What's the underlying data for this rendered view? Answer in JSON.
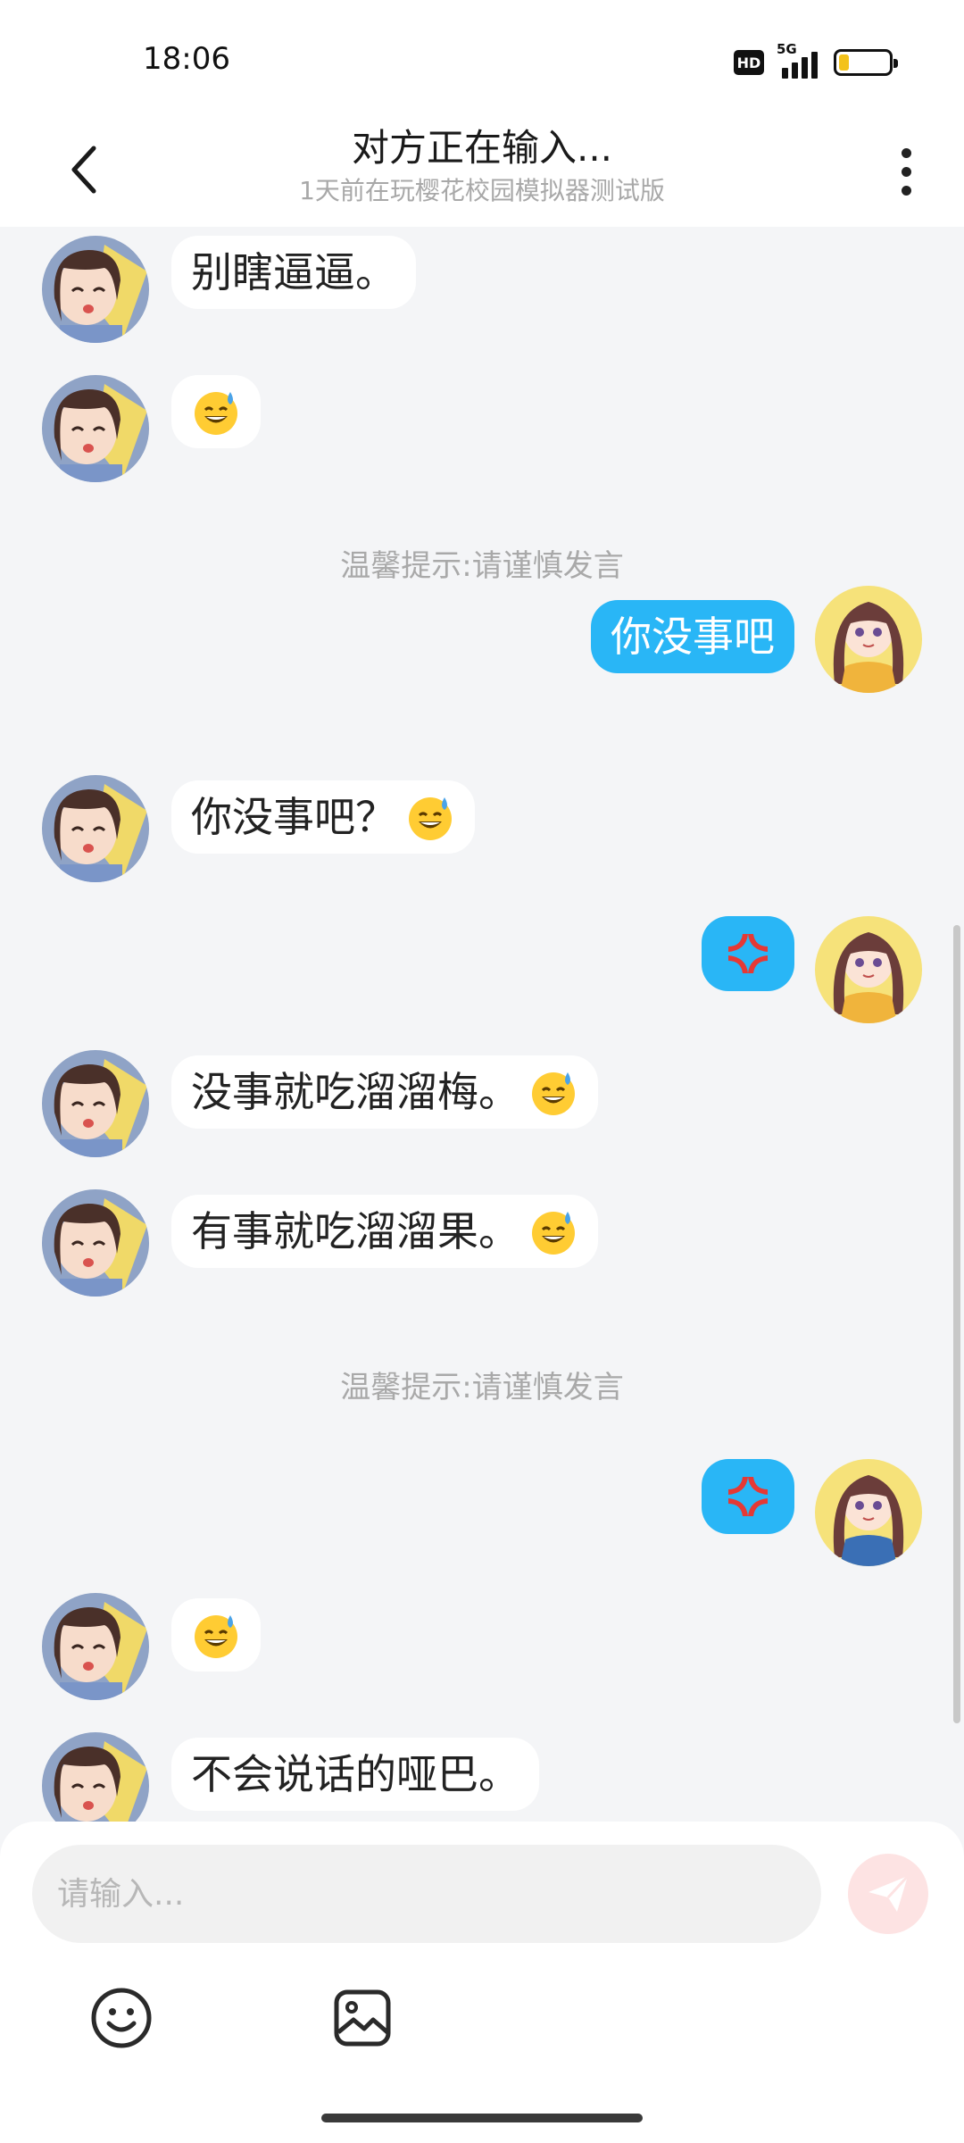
{
  "status": {
    "time": "18:06",
    "hd": "HD",
    "network": "5G",
    "battery_level": 0.2
  },
  "header": {
    "title": "对方正在输入...",
    "subtitle": "1天前在玩樱花校园模拟器测试版"
  },
  "messages": [
    {
      "side": "left",
      "text": "别瞎逼逼。",
      "emoji": ""
    },
    {
      "side": "left",
      "text": "",
      "emoji": "grinning-sweat-icon"
    },
    {
      "type": "notice",
      "text": "温馨提示:请谨慎发言"
    },
    {
      "side": "right",
      "text": "你没事吧",
      "emoji": ""
    },
    {
      "side": "left",
      "text": "你没事吧？",
      "emoji": "grinning-sweat-icon"
    },
    {
      "side": "right",
      "text": "",
      "emoji": "anger-symbol-icon"
    },
    {
      "side": "left",
      "text": "没事就吃溜溜梅。",
      "emoji": "grinning-sweat-icon"
    },
    {
      "side": "left",
      "text": "有事就吃溜溜果。",
      "emoji": "grinning-sweat-icon"
    },
    {
      "type": "notice",
      "text": "温馨提示:请谨慎发言"
    },
    {
      "side": "right",
      "text": "",
      "emoji": "anger-symbol-icon"
    },
    {
      "side": "left",
      "text": "",
      "emoji": "grinning-sweat-icon"
    },
    {
      "side": "left",
      "text": "不会说话的哑巴。",
      "emoji": ""
    }
  ],
  "composer": {
    "placeholder": "请输入...",
    "tools": [
      "emoji-icon",
      "image-icon"
    ]
  },
  "colors": {
    "accent_bubble": "#29b6f6",
    "page_background": "#f4f5f7",
    "send_button": "#fde3e3"
  }
}
